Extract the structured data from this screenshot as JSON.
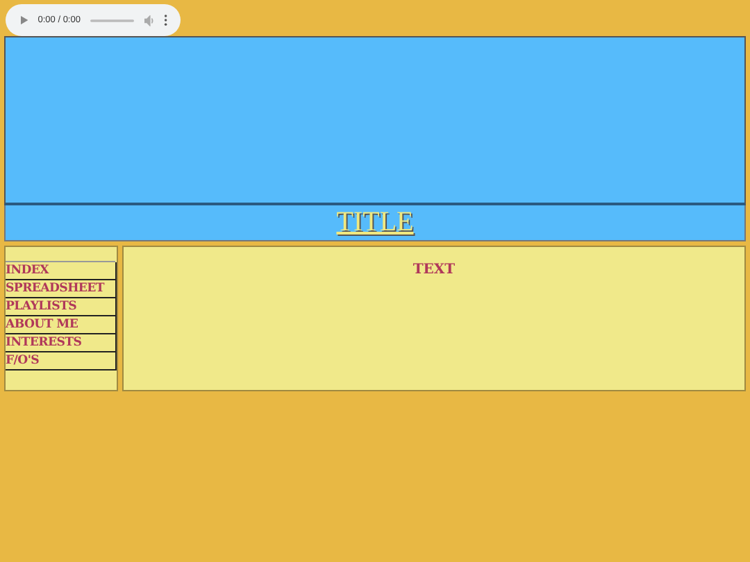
{
  "audio_player": {
    "time": "0:00 / 0:00"
  },
  "header": {
    "title": "TITLE"
  },
  "nav": {
    "items": [
      "INDEX",
      "SPREADSHEET",
      "PLAYLISTS",
      "ABOUT ME",
      "INTERESTS",
      "F/O'S"
    ]
  },
  "content": {
    "text": "TEXT"
  }
}
